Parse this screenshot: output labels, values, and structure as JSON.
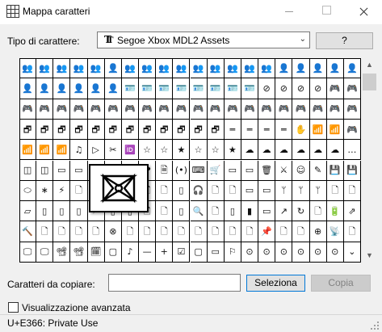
{
  "window": {
    "title": "Mappa caratteri"
  },
  "font": {
    "label": "Tipo di carattere:",
    "value": "Segoe Xbox MDL2 Assets"
  },
  "help": {
    "label": "?"
  },
  "grid": {
    "selected_index": 108,
    "rows": [
      [
        "👥",
        "👥",
        "👥",
        "👥",
        "👥",
        "👤",
        "👥",
        "👥",
        "👥",
        "👥",
        "👥",
        "👥",
        "👥",
        "👥",
        "👥",
        "👤",
        "👤",
        "👤",
        "👤",
        "👤"
      ],
      [
        "👤",
        "👤",
        "👤",
        "👤",
        "👤",
        "👤",
        "🪪",
        "🪪",
        "🪪",
        "🪪",
        "🪪",
        "🪪",
        "🪪",
        "🪪",
        "⊘",
        "⊘",
        "⊘",
        "⊘",
        "🎮",
        "🎮"
      ],
      [
        "🎮",
        "🎮",
        "🎮",
        "🎮",
        "🎮",
        "🎮",
        "🎮",
        "🎮",
        "🎮",
        "🎮",
        "🎮",
        "🎮",
        "🎮",
        "🎮",
        "🎮",
        "🎮",
        "🎮",
        "🎮",
        "🎮",
        "🎮"
      ],
      [
        "🗗",
        "🗗",
        "🗗",
        "🗗",
        "🗗",
        "🗗",
        "🗗",
        "🗗",
        "🗗",
        "🗗",
        "🗗",
        "🗗",
        "═",
        "═",
        "═",
        "═",
        "✋",
        "📶",
        "📶",
        "🎮"
      ],
      [
        "📶",
        "📶",
        "📶",
        "♫",
        "▷",
        "✂",
        "🆔",
        "☆",
        "☆",
        "★",
        "☆",
        "☆",
        "★",
        "☁",
        "☁",
        "☁",
        "☁",
        "☁",
        "☁",
        "…"
      ],
      [
        "◫",
        "◫",
        "▭",
        "▭",
        "🔒",
        "⤧",
        "🎁",
        "❤",
        "🗎",
        "(•)",
        "⌨",
        "🛒",
        "▭",
        "▭",
        "🗑",
        "⚔",
        "☺",
        "✎",
        "💾",
        "💾"
      ],
      [
        "⬭",
        "∗",
        "⚡",
        "🗋",
        "🗋",
        "🗋",
        "🗋",
        "🗋",
        "🗋",
        "▯",
        "🎧",
        "🗋",
        "🗋",
        "▭",
        "▭",
        "ᛘ",
        "ᛘ",
        "ᛘ",
        "🗋",
        "🗋"
      ],
      [
        "▱",
        "▯",
        "▯",
        "▯",
        "🗲",
        "▯",
        "▯",
        "🗋",
        "🗋",
        "▯",
        "🔍",
        "🗋",
        "▯",
        "▮",
        "▭",
        "↗",
        "↻",
        "🗋",
        "🔋",
        "⇗"
      ],
      [
        "🔨",
        "🗋",
        "🗋",
        "🗋",
        "🗋",
        "⊗",
        "🗋",
        "🗋",
        "🗋",
        "🗋",
        "🗋",
        "🗋",
        "🗋",
        "🗋",
        "📌",
        "🗋",
        "🗋",
        "⊕",
        "📡",
        "🗋"
      ],
      [
        "🖵",
        "🖵",
        "📽",
        "📽",
        "🗓",
        "▢",
        "♪",
        "—",
        "+",
        "☑",
        "▢",
        "▭",
        "⚐",
        "⊙",
        "⊙",
        "⊙",
        "⊙",
        "⊙",
        "⊙",
        "⌄"
      ]
    ]
  },
  "copy": {
    "label": "Caratteri da copiare:",
    "value": "",
    "select_label": "Seleziona",
    "copy_label": "Copia"
  },
  "advanced": {
    "label": "Visualizzazione avanzata",
    "checked": false
  },
  "status": {
    "text": "U+E366: Private Use"
  }
}
